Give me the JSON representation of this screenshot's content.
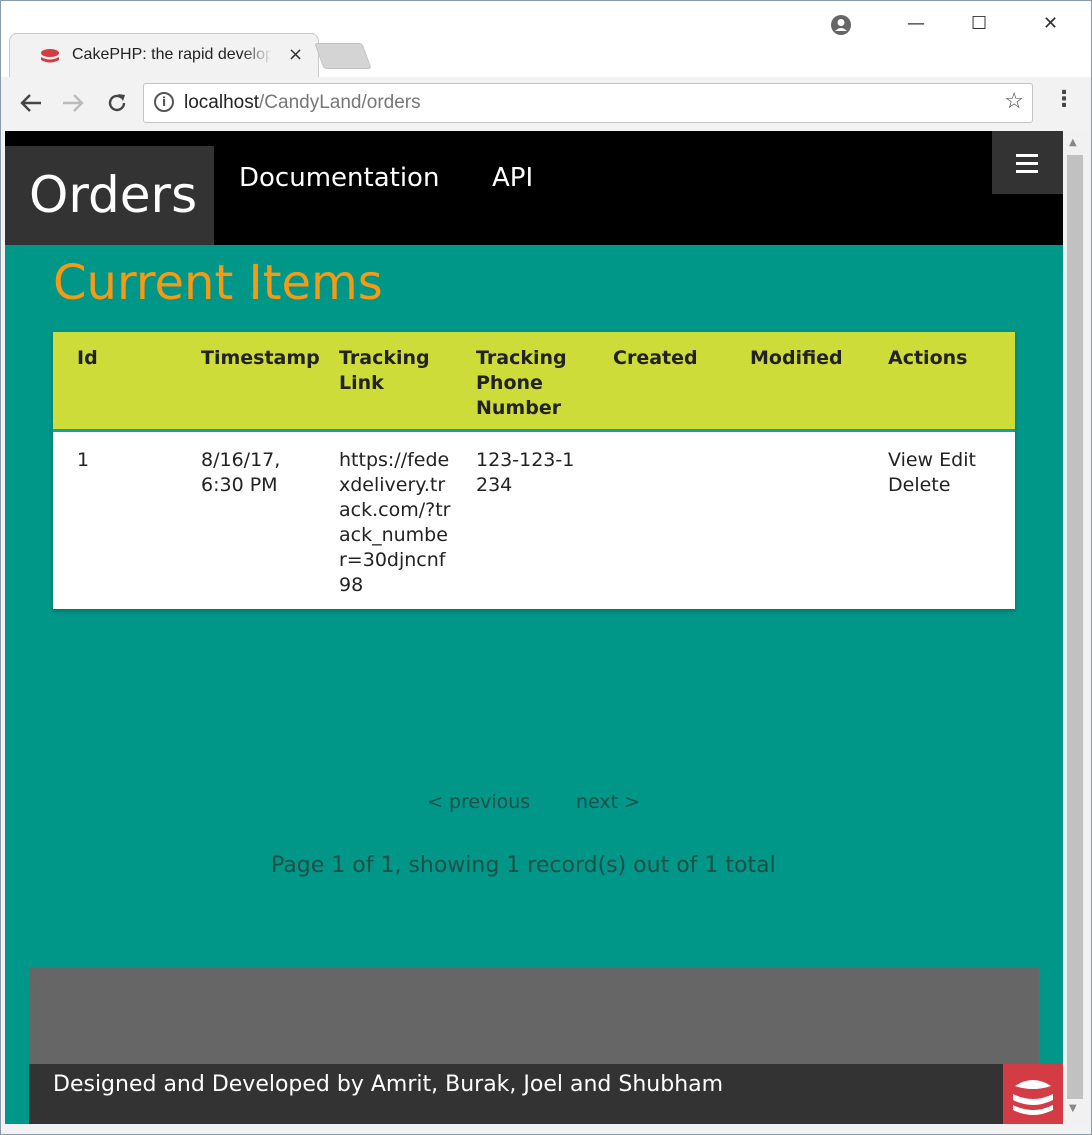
{
  "browser": {
    "tab_title": "CakePHP: the rapid development php framework",
    "tab_close": "×",
    "url_host": "localhost",
    "url_path": "/CandyLand/orders",
    "window_minimize": "—",
    "window_maximize": "☐",
    "window_close": "✕"
  },
  "nav": {
    "brand": "Orders",
    "links": [
      "Documentation",
      "API"
    ]
  },
  "main": {
    "title": "Current Items",
    "table": {
      "headers": [
        "Id",
        "Timestamp",
        "Tracking Link",
        "Tracking Phone Number",
        "Created",
        "Modified",
        "Actions"
      ],
      "rows": [
        {
          "id": "1",
          "timestamp": "8/16/17, 6:30 PM",
          "tracking_link": "https://fedexdelivery.track.com/?track_number=30djncnf98",
          "tracking_phone": "123-123-1234",
          "created": "",
          "modified": "",
          "actions": [
            "View",
            "Edit",
            "Delete"
          ]
        }
      ]
    },
    "pagination": {
      "previous": "< previous",
      "next": "next >",
      "counter": "Page 1 of 1, showing 1 record(s) out of 1 total"
    }
  },
  "footer": {
    "credit": "Designed and Developed by Amrit, Burak, Joel and Shubham"
  },
  "colors": {
    "page_bg": "#009688",
    "title_accent": "#f59a12",
    "table_header": "#cddc39",
    "cake_red": "#d33c44"
  }
}
